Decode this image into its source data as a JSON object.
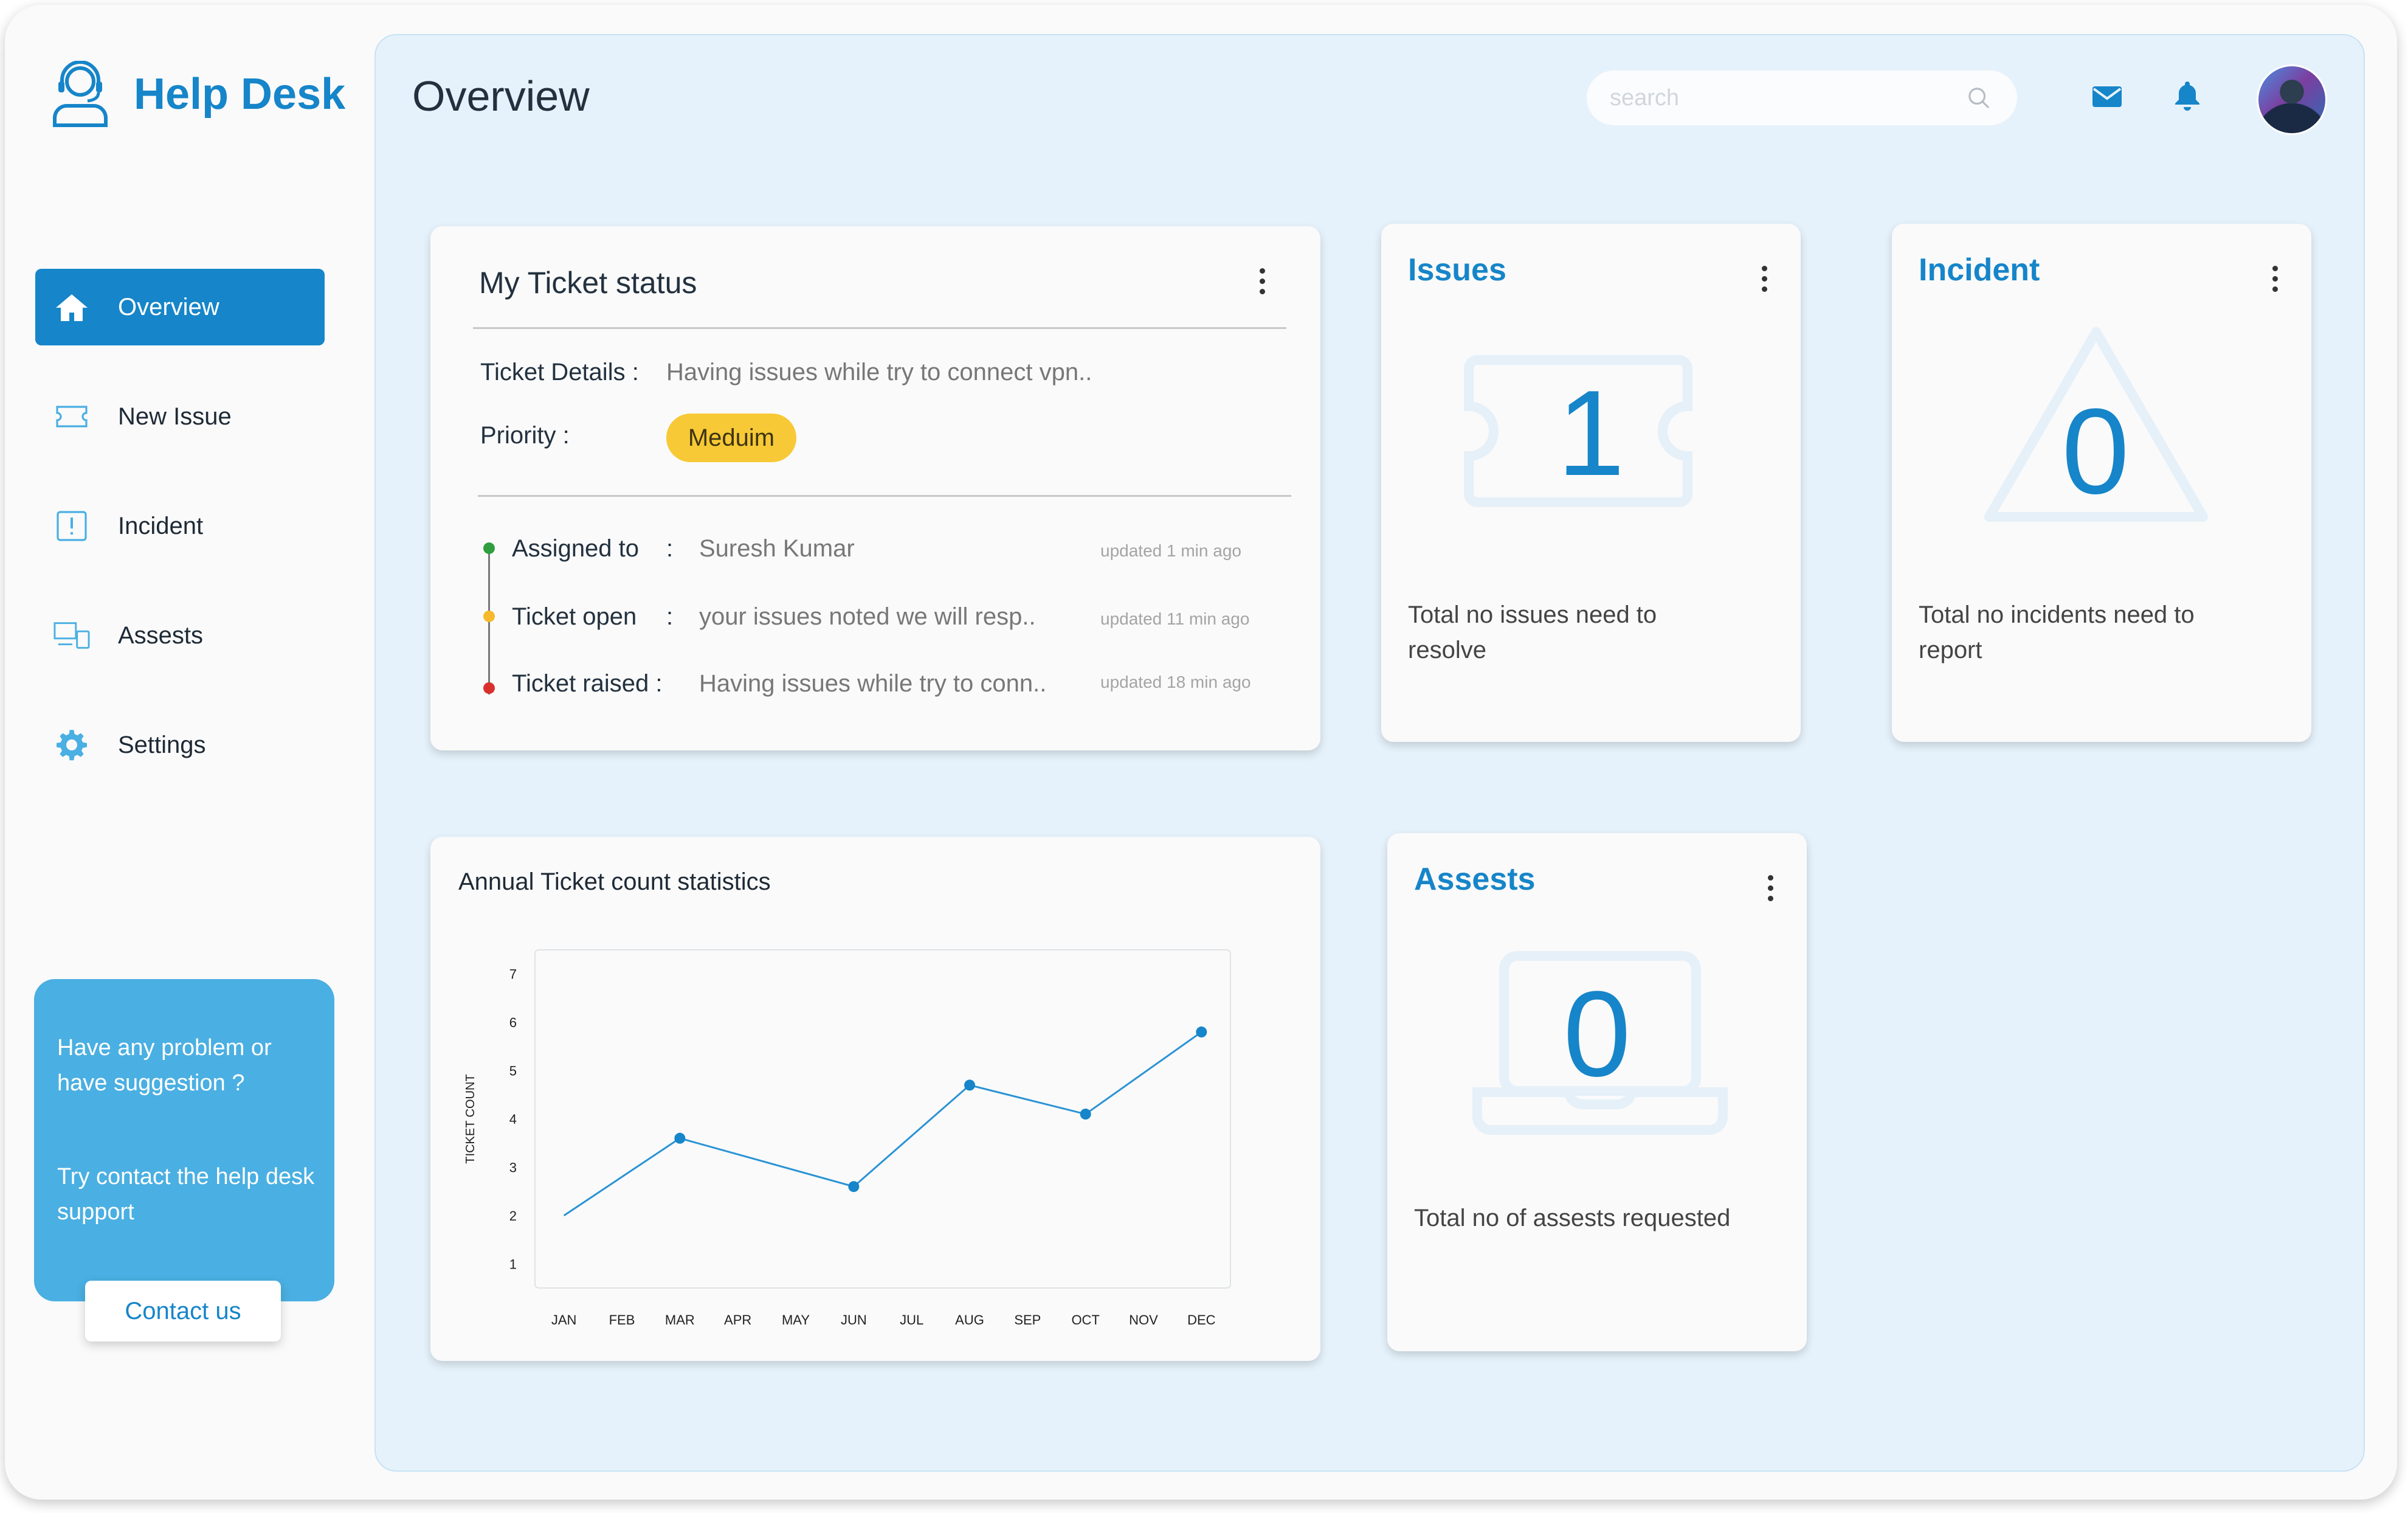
{
  "brand": {
    "name": "Help Desk",
    "icon": "headset-user-icon"
  },
  "sidebar": {
    "items": [
      {
        "label": "Overview",
        "icon": "home-icon",
        "active": true
      },
      {
        "label": "New Issue",
        "icon": "ticket-icon",
        "active": false
      },
      {
        "label": "Incident",
        "icon": "alert-icon",
        "active": false
      },
      {
        "label": "Assests",
        "icon": "devices-icon",
        "active": false
      },
      {
        "label": "Settings",
        "icon": "gear-icon",
        "active": false
      }
    ],
    "support": {
      "line1": "Have any problem or have suggestion ?",
      "line2": "Try contact the help desk support",
      "button": "Contact us"
    }
  },
  "header": {
    "title": "Overview",
    "search_placeholder": "search",
    "search_value": ""
  },
  "ticket_status": {
    "title": "My Ticket status",
    "details_label": "Ticket Details :",
    "details_value": "Having issues while try to connect vpn..",
    "priority_label": "Priority :",
    "priority_value": "Meduim",
    "timeline": [
      {
        "label": "Assigned to",
        "sep": ":",
        "value": "Suresh Kumar",
        "updated": "updated 1 min ago",
        "color": "#2e9e3e"
      },
      {
        "label": "Ticket open",
        "sep": ":",
        "value": "your issues noted we will resp..",
        "updated": "updated 11 min ago",
        "color": "#f5b92b"
      },
      {
        "label": "Ticket raised :",
        "sep": "",
        "value": "Having issues while try to conn..",
        "updated": "updated 18 min ago",
        "color": "#d9302c"
      }
    ]
  },
  "issues": {
    "title": "Issues",
    "count": "1",
    "desc": "Total no issues need to resolve"
  },
  "incident": {
    "title": "Incident",
    "count": "0",
    "desc": "Total no incidents need to report"
  },
  "assets": {
    "title": "Assests",
    "count": "0",
    "desc": "Total no of assests requested"
  },
  "colors": {
    "accent": "#1685c9",
    "support_bg": "#4aafe2",
    "main_bg": "#e6f2fb",
    "badge": "#f7c936"
  },
  "chart_data": {
    "type": "line",
    "title": "Annual Ticket count statistics",
    "ylabel": "TICKET COUNT",
    "xlabel": "",
    "categories": [
      "JAN",
      "FEB",
      "MAR",
      "APR",
      "MAY",
      "JUN",
      "JUL",
      "AUG",
      "SEP",
      "OCT",
      "NOV",
      "DEC"
    ],
    "yticks": [
      1,
      2,
      3,
      4,
      5,
      6,
      7
    ],
    "ylim": [
      0.5,
      7.5
    ],
    "points": [
      {
        "x": "JAN",
        "y": 2.0,
        "marker": false
      },
      {
        "x": "MAR",
        "y": 3.6,
        "marker": true
      },
      {
        "x": "JUN",
        "y": 2.6,
        "marker": true
      },
      {
        "x": "AUG",
        "y": 4.7,
        "marker": true
      },
      {
        "x": "OCT",
        "y": 4.1,
        "marker": true
      },
      {
        "x": "DEC",
        "y": 5.8,
        "marker": true
      }
    ],
    "grid": false,
    "color": "#2a93d5"
  }
}
